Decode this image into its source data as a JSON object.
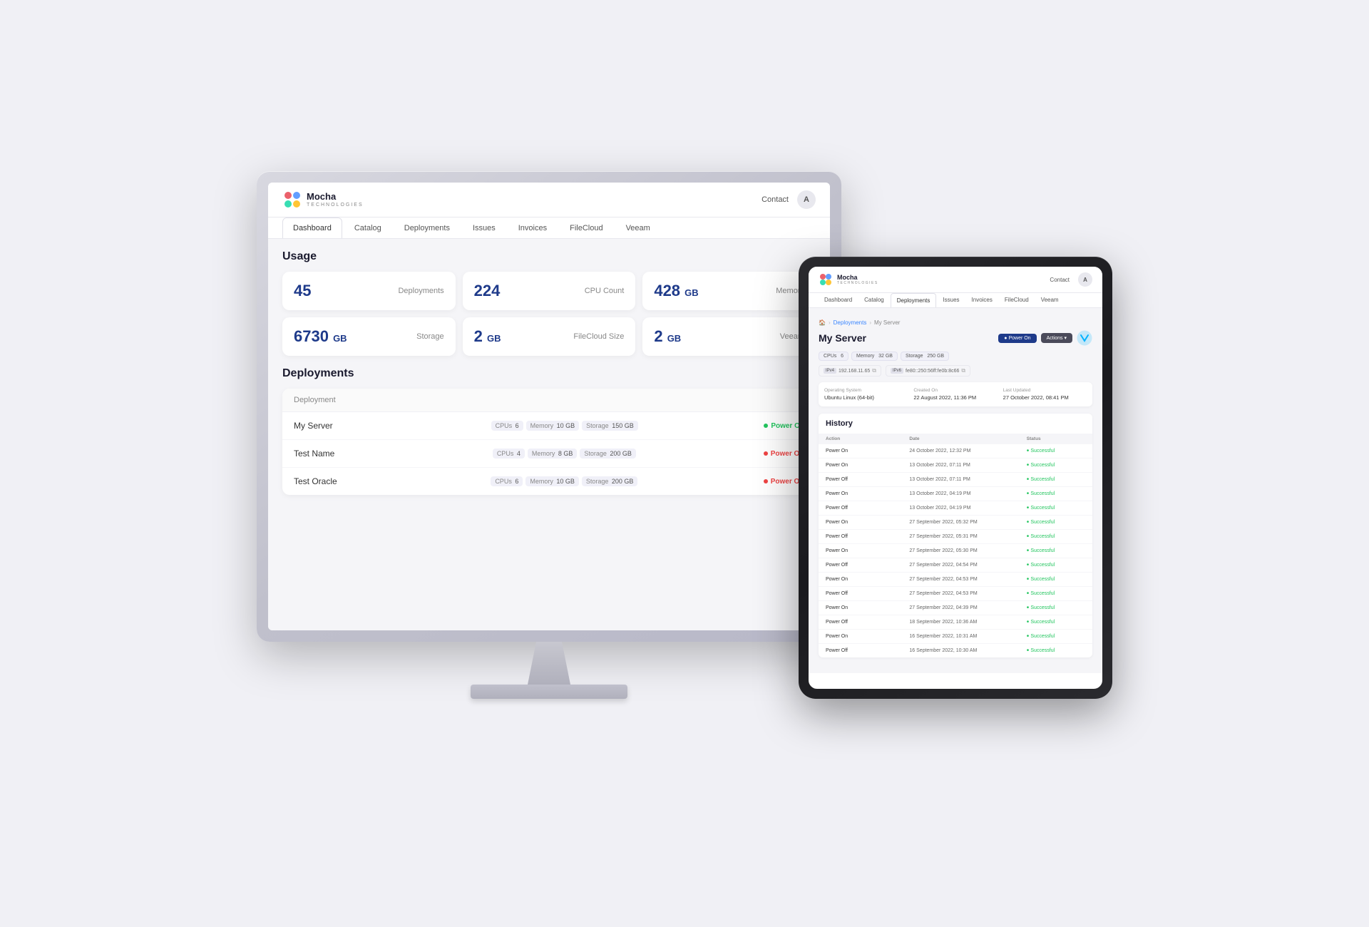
{
  "monitor": {
    "app": {
      "header": {
        "logo_name": "Mocha",
        "logo_sub": "Technologies",
        "contact_label": "Contact",
        "avatar_label": "A"
      },
      "nav": {
        "tabs": [
          {
            "label": "Dashboard",
            "active": true
          },
          {
            "label": "Catalog",
            "active": false
          },
          {
            "label": "Deployments",
            "active": false
          },
          {
            "label": "Issues",
            "active": false
          },
          {
            "label": "Invoices",
            "active": false
          },
          {
            "label": "FileCloud",
            "active": false
          },
          {
            "label": "Veeam",
            "active": false
          }
        ]
      },
      "usage": {
        "title": "Usage",
        "stats": [
          {
            "value": "45",
            "unit": "",
            "label": "Deployments"
          },
          {
            "value": "224",
            "unit": "",
            "label": "CPU Count"
          },
          {
            "value": "428",
            "unit": "GB",
            "label": "Memory"
          },
          {
            "value": "6730",
            "unit": "GB",
            "label": "Storage"
          },
          {
            "value": "2",
            "unit": "GB",
            "label": "FileCloud Size"
          },
          {
            "value": "2",
            "unit": "GB",
            "label": "Veeam"
          }
        ]
      },
      "deployments": {
        "title": "Deployments",
        "table_header": "Deployment",
        "rows": [
          {
            "name": "My Server",
            "cpus": "6",
            "memory": "10 GB",
            "storage": "150 GB",
            "status": "Power On",
            "status_type": "on"
          },
          {
            "name": "Test Name",
            "cpus": "4",
            "memory": "8 GB",
            "storage": "200 GB",
            "status": "Power Off",
            "status_type": "off"
          },
          {
            "name": "Test Oracle",
            "cpus": "6",
            "memory": "10 GB",
            "storage": "200 GB",
            "status": "Power Off",
            "status_type": "off"
          }
        ]
      }
    }
  },
  "ipad": {
    "app": {
      "header": {
        "logo_name": "Mocha",
        "logo_sub": "Technologies",
        "contact_label": "Contact",
        "avatar_label": "A"
      },
      "nav": {
        "tabs": [
          {
            "label": "Dashboard",
            "active": false
          },
          {
            "label": "Catalog",
            "active": false
          },
          {
            "label": "Deployments",
            "active": true
          },
          {
            "label": "Issues",
            "active": false
          },
          {
            "label": "Invoices",
            "active": false
          },
          {
            "label": "FileCloud",
            "active": false
          },
          {
            "label": "Veeam",
            "active": false
          }
        ]
      },
      "breadcrumb": {
        "items": [
          "Deployments",
          "My Server"
        ]
      },
      "server": {
        "title": "My Server",
        "tags": [
          {
            "label": "CPUs",
            "value": "6"
          },
          {
            "label": "Memory",
            "value": "32 GB"
          },
          {
            "label": "Storage",
            "value": "250 GB"
          }
        ],
        "ipv4": "192.168.11.65",
        "ipv6": "fe80::250:56ff:fe0b:8c66",
        "power_btn": "● Power On",
        "actions_btn": "Actions ▾",
        "info": {
          "os_label": "Operating System",
          "os_value": "Ubuntu Linux (64-bit)",
          "created_label": "Created On",
          "created_value": "22 August 2022, 11:36 PM",
          "updated_label": "Last Updated",
          "updated_value": "27 October 2022, 08:41 PM"
        }
      },
      "history": {
        "title": "History",
        "headers": [
          "Action",
          "Date",
          "Status"
        ],
        "rows": [
          {
            "action": "Power On",
            "date": "24 October 2022, 12:32 PM",
            "status": "Successful"
          },
          {
            "action": "Power On",
            "date": "13 October 2022, 07:11 PM",
            "status": "Successful"
          },
          {
            "action": "Power Off",
            "date": "13 October 2022, 07:11 PM",
            "status": "Successful"
          },
          {
            "action": "Power On",
            "date": "13 October 2022, 04:19 PM",
            "status": "Successful"
          },
          {
            "action": "Power Off",
            "date": "13 October 2022, 04:19 PM",
            "status": "Successful"
          },
          {
            "action": "Power On",
            "date": "27 September 2022, 05:32 PM",
            "status": "Successful"
          },
          {
            "action": "Power Off",
            "date": "27 September 2022, 05:31 PM",
            "status": "Successful"
          },
          {
            "action": "Power On",
            "date": "27 September 2022, 05:30 PM",
            "status": "Successful"
          },
          {
            "action": "Power Off",
            "date": "27 September 2022, 04:54 PM",
            "status": "Successful"
          },
          {
            "action": "Power On",
            "date": "27 September 2022, 04:53 PM",
            "status": "Successful"
          },
          {
            "action": "Power Off",
            "date": "27 September 2022, 04:53 PM",
            "status": "Successful"
          },
          {
            "action": "Power On",
            "date": "27 September 2022, 04:39 PM",
            "status": "Successful"
          },
          {
            "action": "Power Off",
            "date": "18 September 2022, 10:36 AM",
            "status": "Successful"
          },
          {
            "action": "Power On",
            "date": "16 September 2022, 10:31 AM",
            "status": "Successful"
          },
          {
            "action": "Power Off",
            "date": "16 September 2022, 10:30 AM",
            "status": "Successful"
          }
        ]
      }
    }
  }
}
